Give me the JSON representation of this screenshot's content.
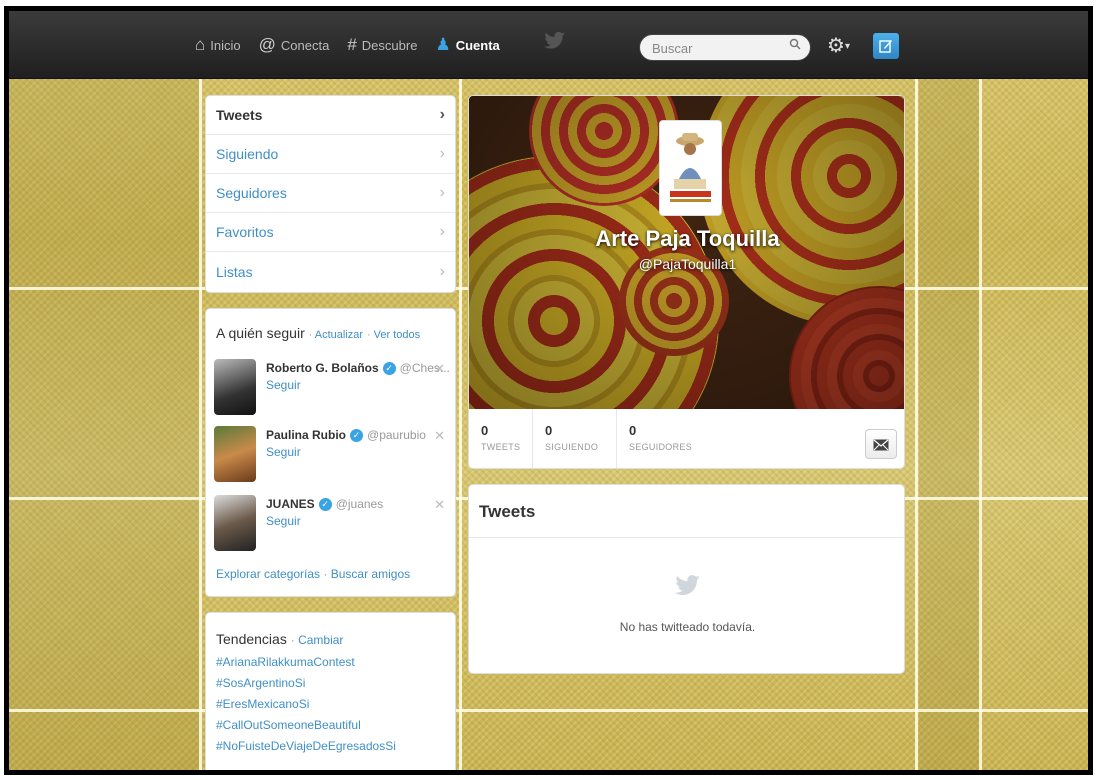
{
  "nav": {
    "items": [
      {
        "icon": "home-icon",
        "glyph": "⌂",
        "label": "Inicio"
      },
      {
        "icon": "at-icon",
        "glyph": "@",
        "label": "Conecta"
      },
      {
        "icon": "hash-icon",
        "glyph": "#",
        "label": "Descubre"
      },
      {
        "icon": "user-icon",
        "glyph": "♟",
        "label": "Cuenta"
      }
    ],
    "search_placeholder": "Buscar"
  },
  "menu": {
    "items": [
      {
        "label": "Tweets"
      },
      {
        "label": "Siguiendo"
      },
      {
        "label": "Seguidores"
      },
      {
        "label": "Favoritos"
      },
      {
        "label": "Listas"
      }
    ]
  },
  "who_to_follow": {
    "title": "A quién seguir",
    "refresh": "Actualizar",
    "view_all": "Ver todos",
    "suggestions": [
      {
        "name": "Roberto G. Bolaños",
        "handle": "@Ches...",
        "follow": "Seguir"
      },
      {
        "name": "Paulina Rubio",
        "handle": "@paurubio",
        "follow": "Seguir"
      },
      {
        "name": "JUANES",
        "handle": "@juanes",
        "follow": "Seguir"
      }
    ],
    "explore": "Explorar categorías",
    "find_friends": "Buscar amigos"
  },
  "trends": {
    "title": "Tendencias",
    "change": "Cambiar",
    "items": [
      "#ArianaRilakkumaContest",
      "#SosArgentinoSi",
      "#EresMexicanoSi",
      "#CallOutSomeoneBeautiful",
      "#NoFuisteDeViajeDeEgresadosSi"
    ]
  },
  "profile": {
    "name": "Arte Paja Toquilla",
    "handle": "@PajaToquilla1",
    "stats": [
      {
        "value": "0",
        "label": "TWEETS"
      },
      {
        "value": "0",
        "label": "SIGUIENDO"
      },
      {
        "value": "0",
        "label": "SEGUIDORES"
      }
    ]
  },
  "timeline": {
    "title": "Tweets",
    "empty": "No has twitteado todavía."
  },
  "colors": {
    "accent": "#3aa3e3",
    "link": "#3f8fc7",
    "topbar": "#2a2a2a",
    "background": "#d1bd5e"
  }
}
